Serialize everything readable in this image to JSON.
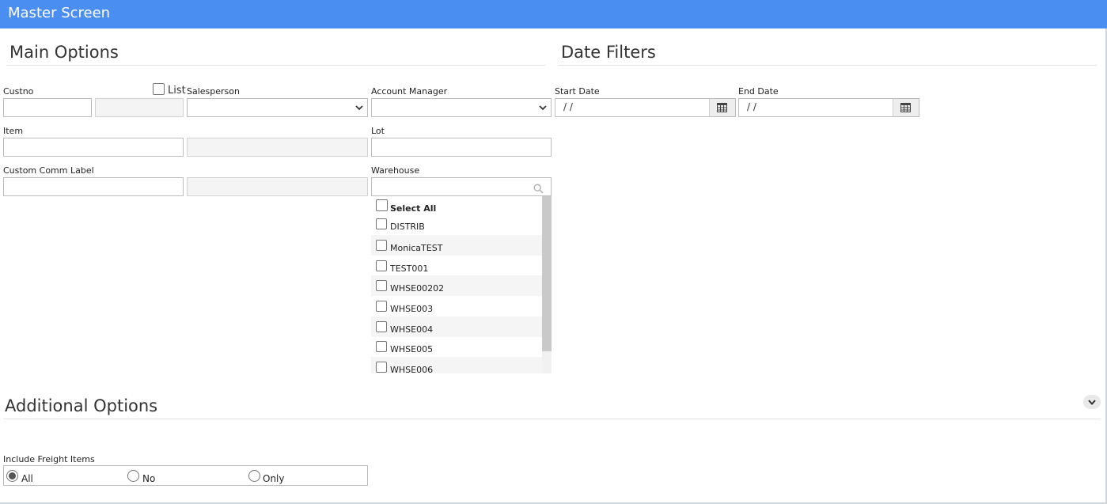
{
  "window": {
    "title": "Master Screen"
  },
  "sections": {
    "main": "Main Options",
    "dates": "Date Filters",
    "additional": "Additional Options"
  },
  "fields": {
    "custno_label": "Custno",
    "list_label": "List",
    "salesperson_label": "Salesperson",
    "account_manager_label": "Account Manager",
    "item_label": "Item",
    "lot_label": "Lot",
    "custom_comm_label": "Custom Comm Label",
    "warehouse_label": "Warehouse",
    "start_date_label": "Start Date",
    "start_date_value": " /  /",
    "end_date_label": "End Date",
    "end_date_value": " /  /"
  },
  "warehouse": {
    "search_placeholder": "",
    "select_all": "Select All",
    "items": [
      "DISTRIB",
      "MonicaTEST",
      "TEST001",
      "WHSE00202",
      "WHSE003",
      "WHSE004",
      "WHSE005",
      "WHSE006"
    ]
  },
  "freight": {
    "label": "Include Freight Items",
    "options": [
      "All",
      "No",
      "Only"
    ],
    "selected": "All"
  },
  "icons": {
    "calendar": "calendar-icon",
    "search": "search-icon",
    "chevron": "chevron-down-icon"
  },
  "colors": {
    "titlebar": "#4b8ef1"
  }
}
